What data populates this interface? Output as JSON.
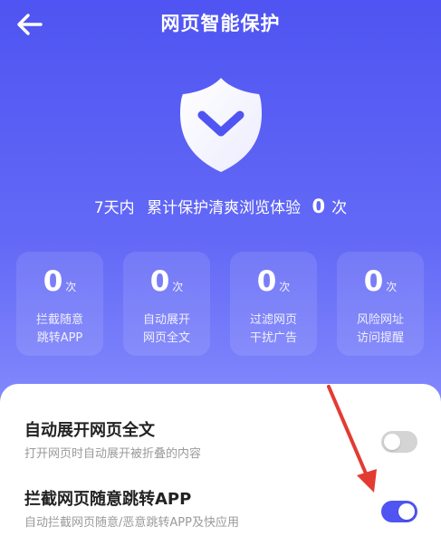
{
  "header": {
    "title": "网页智能保护",
    "back_icon": "arrow-left-icon"
  },
  "hero": {
    "icon": "shield-chevron-icon",
    "summary_prefix": "7天内",
    "summary_text": "累计保护清爽浏览体验",
    "summary_count": "0",
    "summary_suffix": "次"
  },
  "stats": [
    {
      "value": "0",
      "unit": "次",
      "line1": "拦截随意",
      "line2": "跳转APP"
    },
    {
      "value": "0",
      "unit": "次",
      "line1": "自动展开",
      "line2": "网页全文"
    },
    {
      "value": "0",
      "unit": "次",
      "line1": "过滤网页",
      "line2": "干扰广告"
    },
    {
      "value": "0",
      "unit": "次",
      "line1": "风险网址",
      "line2": "访问提醒"
    }
  ],
  "settings": [
    {
      "title": "自动展开网页全文",
      "description": "打开网页时自动展开被折叠的内容",
      "enabled": false
    },
    {
      "title": "拦截网页随意跳转APP",
      "description": "自动拦截网页随意/恶意跳转APP及快应用",
      "enabled": true
    }
  ],
  "annotation": {
    "arrow_color": "#e33b32"
  },
  "colors": {
    "header_gradient_top": "#4f54f2",
    "header_gradient_bottom": "#9ca2ff",
    "toggle_on": "#4f54f2",
    "toggle_off": "#d4d4d4"
  }
}
